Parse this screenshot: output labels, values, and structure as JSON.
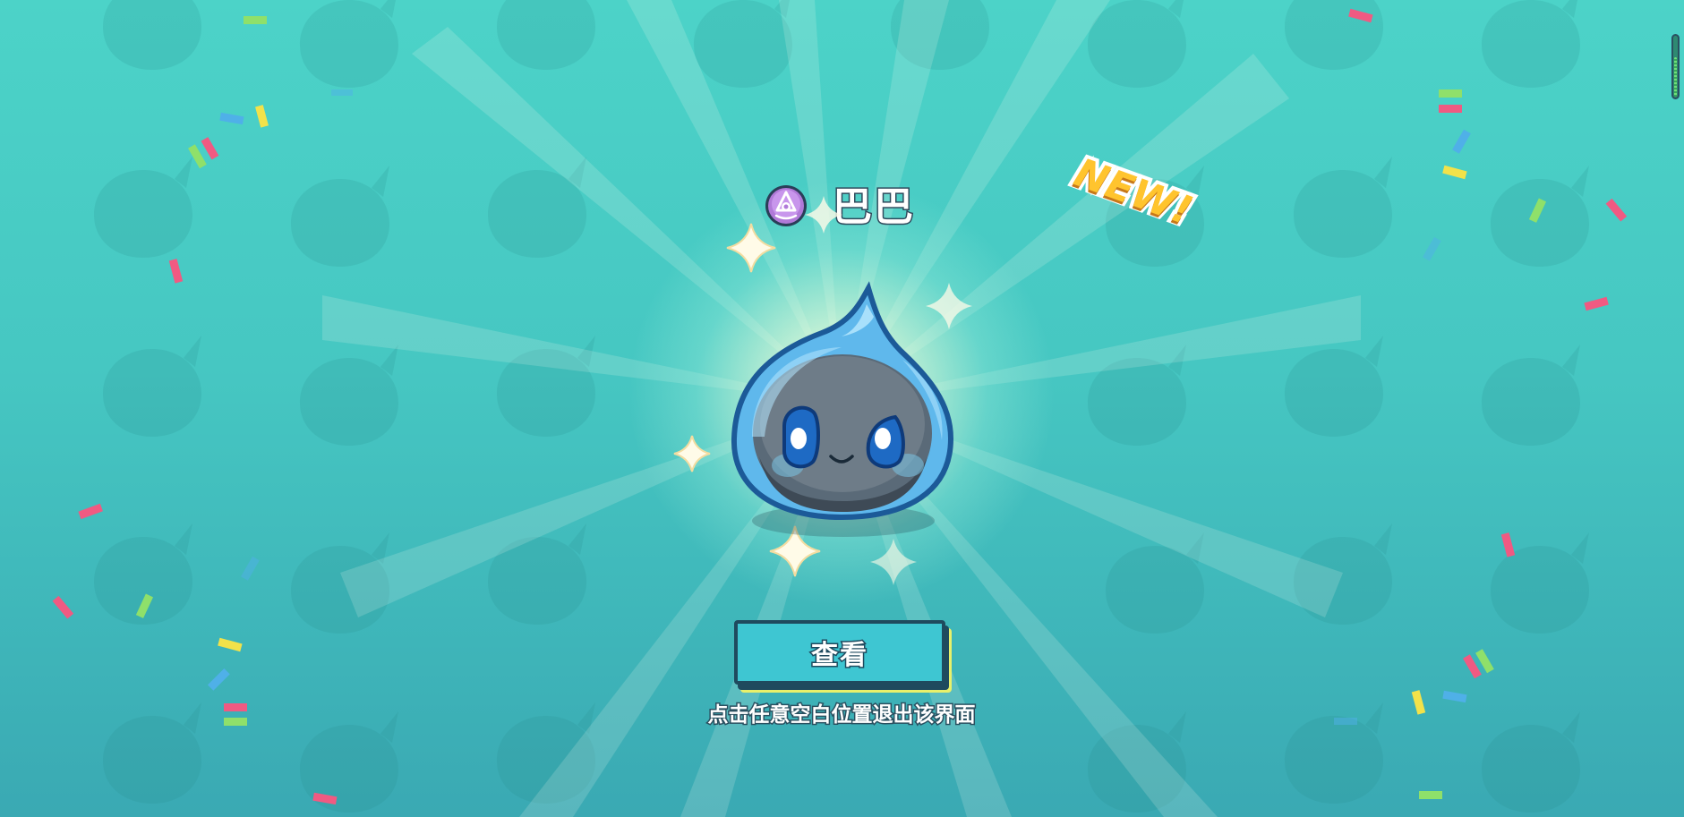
{
  "reward": {
    "rarity_icon": "purple-rarity-emblem-icon",
    "pet_name": "巴巴",
    "new_label": "NEW!",
    "pet_icon": "blue-water-droplet-pet"
  },
  "actions": {
    "view_label": "查看",
    "exit_hint": "点击任意空白位置退出该界面"
  },
  "colors": {
    "background": "#46c7c2",
    "button": "#3ec6d2",
    "outline": "#1f4a5e",
    "new_badge": "#ffc42e",
    "rarity": "#b07ad8"
  }
}
